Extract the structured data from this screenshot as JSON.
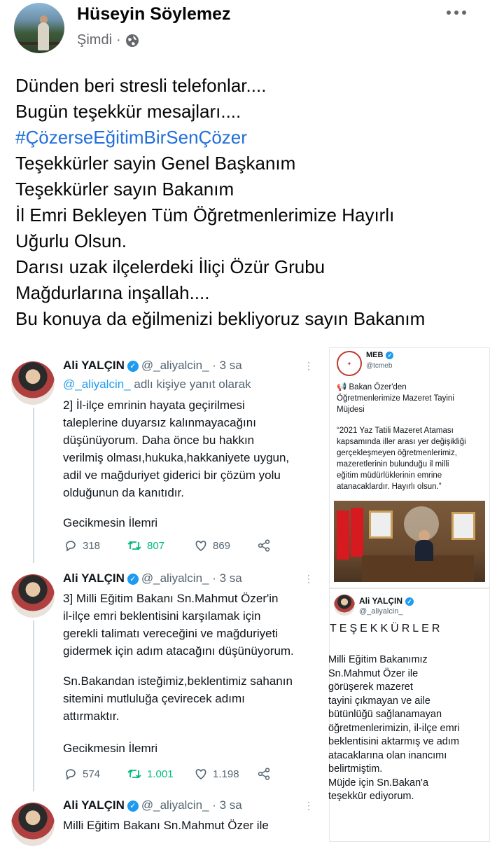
{
  "post": {
    "author": "Hüseyin Söylemez",
    "time": "Şimdi",
    "separator": "·",
    "lines": [
      "Dünden beri stresli telefonlar....",
      "Bugün teşekkür mesajları...."
    ],
    "hashtag": "#ÇözerseEğitimBirSenÇözer",
    "lines2": [
      "Teşekkürler sayin Genel Başkanım",
      "Teşekkürler sayın Bakanım",
      "İl Emri Bekleyen Tüm Öğretmenlerimize Hayırlı",
      "Uğurlu Olsun.",
      "Darısı uzak ilçelerdeki İliçi Özür Grubu",
      "Mağdurlarına inşallah....",
      "Bu konuya da eğilmenizi bekliyoruz sayın Bakanım"
    ]
  },
  "tweets": [
    {
      "name": "Ali YALÇIN",
      "handle": "@_aliyalcin_ · 3 sa",
      "reply_handle": "@_aliyalcin_",
      "reply_suffix": " adlı kişiye yanıt olarak",
      "body": [
        "2] İl-ilçe emrinin hayata geçirilmesi",
        "taleplerine duyarsız kalınmayacağını",
        "düşünüyorum. Daha önce bu hakkın",
        "verilmiş olması,hukuka,hakkaniyete uygun,",
        "adil ve mağduriyet giderici bir çözüm yolu",
        "olduğunun da kanıtıdır."
      ],
      "tag": "Gecikmesin İlemri",
      "replies": "318",
      "retweets": "807",
      "likes": "869"
    },
    {
      "name": "Ali YALÇIN",
      "handle": "@_aliyalcin_ · 3 sa",
      "body": [
        "3] Milli Eğitim Bakanı Sn.Mahmut Özer'in",
        "il-ilçe emri beklentisini karşılamak için",
        "gerekli talimatı vereceğini ve mağduriyeti",
        "gidermek için adım atacağını düşünüyorum."
      ],
      "body2": [
        "Sn.Bakandan isteğimiz,beklentimiz sahanın",
        "sitemini mutluluğa çevirecek adımı",
        "attırmaktır."
      ],
      "tag": "Gecikmesin İlemri",
      "replies": "574",
      "retweets": "1.001",
      "likes": "1.198"
    },
    {
      "name": "Ali YALÇIN",
      "handle": "@_aliyalcin_ · 3 sa",
      "body": [
        "Milli Eğitim Bakanı Sn.Mahmut Özer ile"
      ]
    }
  ],
  "meb": {
    "name": "MEB",
    "handle": "@tcmeb",
    "headline": [
      "📢 Bakan Özer'den",
      "Öğretmenlerimize Mazeret Tayini",
      "Müjdesi"
    ],
    "quote": [
      "“2021 Yaz Tatili Mazeret Ataması",
      "kapsamında iller arası yer değişikliği",
      "gerçekleşmeyen öğretmenlerimiz,",
      "mazeretlerinin bulunduğu il milli",
      "eğitim müdürlüklerinin emrine",
      "atanacaklardır. Hayırlı olsun.”"
    ]
  },
  "ali_card": {
    "name": "Ali YALÇIN",
    "handle": "@_aliyalcin_",
    "title": "TEŞEKKÜRLER",
    "body": [
      "Milli Eğitim Bakanımız",
      "Sn.Mahmut Özer ile",
      "görüşerek mazeret",
      "tayini çıkmayan ve aile",
      "bütünlüğü sağlanamayan",
      "öğretmenlerimizin, il-ilçe emri",
      "beklentisini aktarmış ve adım",
      "atacaklarına olan inancımı",
      "belirtmiştim.",
      "Müjde için Sn.Bakan'a",
      "teşekkür ediyorum."
    ]
  },
  "colors": {
    "hashtag": "#216fdb",
    "retweet": "#00ba7c",
    "verified": "#1d9bf0",
    "muted": "#536471"
  },
  "icons": [
    "globe-icon",
    "more-icon",
    "verified-icon",
    "reply-icon",
    "retweet-icon",
    "like-icon",
    "share-icon"
  ]
}
